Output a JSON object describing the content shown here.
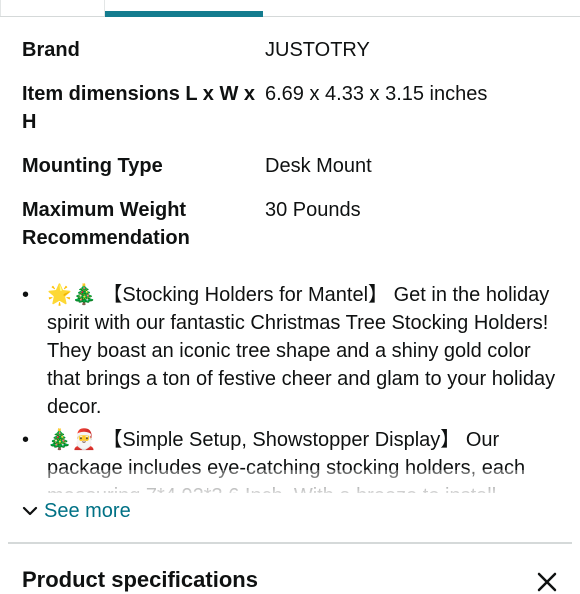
{
  "specs": [
    {
      "label": "Brand",
      "value": "JUSTOTRY"
    },
    {
      "label": "Item dimensions L x W x H",
      "value": "6.69 x 4.33 x 3.15 inches"
    },
    {
      "label": "Mounting Type",
      "value": "Desk Mount"
    },
    {
      "label": "Maximum Weight Recommendation",
      "value": "30 Pounds"
    }
  ],
  "bullets": [
    {
      "text": "🌟🎄 【Stocking Holders for Mantel】 Get in the holiday spirit with our fantastic Christmas Tree Stocking Holders! They boast an iconic tree shape and a shiny gold color that brings a ton of festive cheer and glam to your holiday decor."
    },
    {
      "text": "🎄🎅 【Simple Setup, Showstopper Display】 Our package includes eye-catching stocking holders, each measuring 7*4.92*3.6 Inch. With a breeze to install"
    }
  ],
  "see_more": "See more",
  "section_title": "Product specifications",
  "colors": {
    "link": "#007185",
    "tab_indicator": "#147c8f",
    "text": "#0f1111"
  },
  "icons": {
    "see_more": "chevron-down-icon",
    "close": "close-icon"
  }
}
